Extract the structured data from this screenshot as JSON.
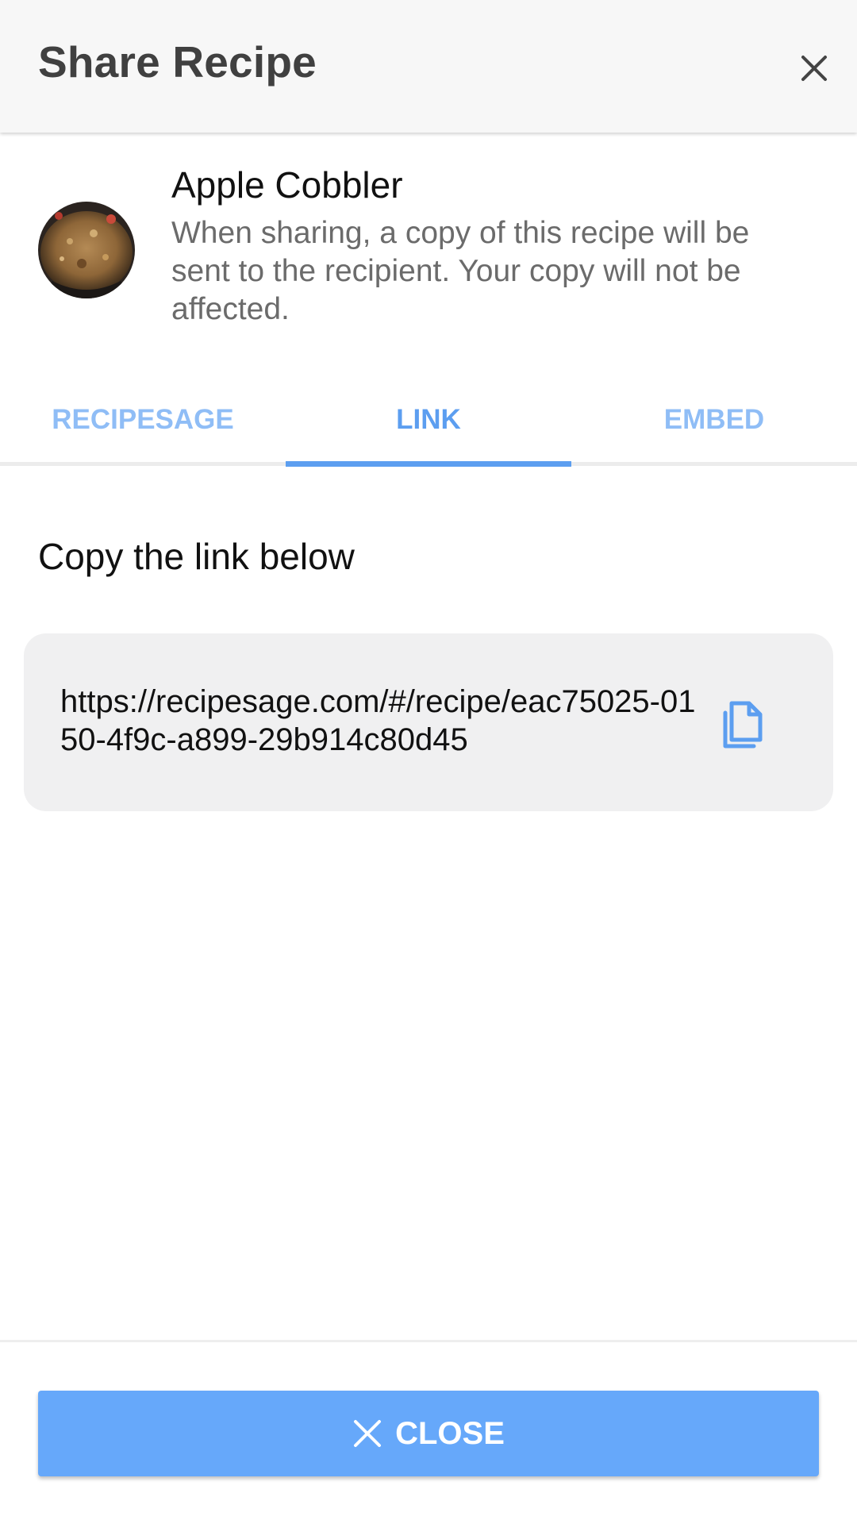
{
  "header": {
    "title": "Share Recipe"
  },
  "recipe": {
    "name": "Apple Cobbler",
    "description": "When sharing, a copy of this recipe will be sent to the recipient. Your copy will not be affected.",
    "image_icon": "recipe-thumbnail"
  },
  "tabs": [
    {
      "label": "RECIPESAGE",
      "active": false
    },
    {
      "label": "LINK",
      "active": true
    },
    {
      "label": "EMBED",
      "active": false
    }
  ],
  "link_section": {
    "heading": "Copy the link below",
    "url": "https://recipesage.com/#/recipe/eac75025-0150-4f9c-a899-29b914c80d45",
    "copy_icon": "copy-icon"
  },
  "footer": {
    "close_label": "CLOSE",
    "close_icon": "close-icon"
  },
  "colors": {
    "accent": "#5c9ef0",
    "tab_inactive": "#8fbdf6",
    "button": "#66a8fa",
    "header_bg": "#f7f7f7",
    "link_box_bg": "#f0f0f1"
  }
}
